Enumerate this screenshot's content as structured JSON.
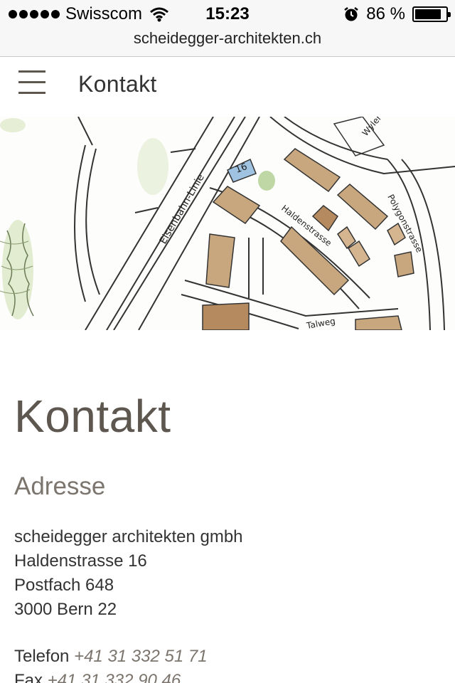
{
  "status_bar": {
    "carrier": "Swisscom",
    "time": "15:23",
    "battery_percent": "86 %",
    "battery_level": 0.86,
    "icons": [
      "signal-dots-icon",
      "wifi-icon",
      "alarm-icon",
      "battery-icon"
    ]
  },
  "browser": {
    "url": "scheidegger-architekten.ch"
  },
  "header": {
    "menu_icon": "hamburger-icon",
    "title": "Kontakt"
  },
  "map": {
    "labels": {
      "railway": "Eisenbahn-Linie",
      "street_main": "Haldenstrasse",
      "street_side": "Polygonstrasse",
      "street_lower": "Talweg",
      "street_top": "Wyler",
      "house_number": "16"
    }
  },
  "main": {
    "heading": "Kontakt",
    "address_heading": "Adresse",
    "address_lines": [
      "scheidegger architekten gmbh",
      "Haldenstrasse 16",
      "Postfach 648",
      "3000 Bern 22"
    ],
    "phone_label": "Telefon",
    "phone_number": "+41 31 332 51 71",
    "fax_label": "Fax",
    "fax_number": "+41 31 332 90 46"
  },
  "colors": {
    "heading": "#5e5750",
    "accent_number": "#7c756e",
    "bar_background": "#f7f7f7"
  }
}
